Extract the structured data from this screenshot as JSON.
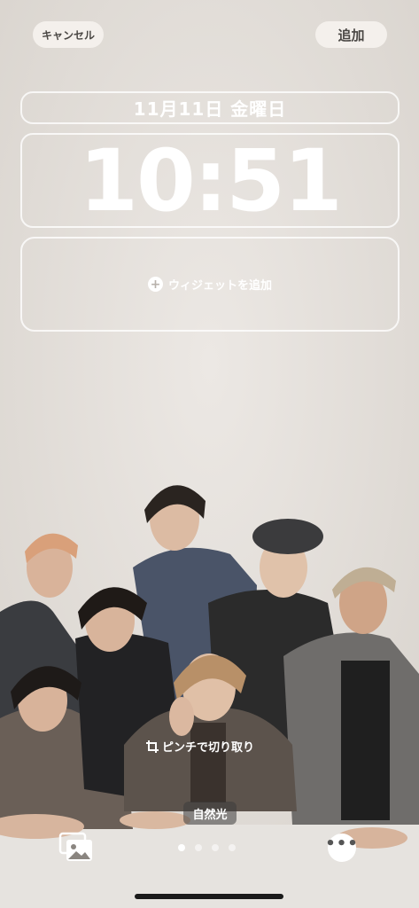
{
  "top_bar": {
    "cancel_label": "キャンセル",
    "add_label": "追加"
  },
  "lock_screen": {
    "date": "11月11日 金曜日",
    "time": "10:51",
    "widget_add_label": "ウィジェットを追加"
  },
  "editor": {
    "pinch_hint": "ピンチで切り取り",
    "filter_name": "自然光",
    "pages": {
      "count": 4,
      "active_index": 0
    }
  },
  "icons": {
    "plus": "plus-circle-icon",
    "crop": "crop-icon",
    "photos": "photo-library-icon",
    "more": "ellipsis-icon"
  },
  "colors": {
    "background": "#e4dfda",
    "button_bg": "#f5f2ee",
    "button_text": "#4a4744",
    "outline": "#ffffff"
  }
}
